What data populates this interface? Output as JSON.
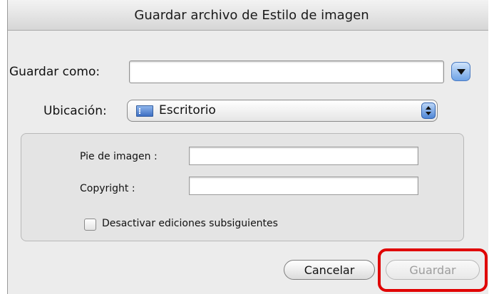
{
  "dialog": {
    "title": "Guardar archivo de Estilo de imagen",
    "save_as_label": "Guardar como:",
    "save_as_value": "",
    "location_label": "Ubicación:",
    "location_value": "Escritorio",
    "location_icon": "folder-icon",
    "disclosure_icon": "chevron-down-icon"
  },
  "options": {
    "caption_label": "Pie de imagen :",
    "caption_value": "",
    "copyright_label": "Copyright :",
    "copyright_value": "",
    "disable_edits_label": "Desactivar ediciones subsiguientes",
    "disable_edits_checked": false
  },
  "buttons": {
    "cancel_label": "Cancelar",
    "save_label": "Guardar",
    "save_enabled": false
  },
  "annotation": {
    "highlight_color": "#e00000"
  }
}
